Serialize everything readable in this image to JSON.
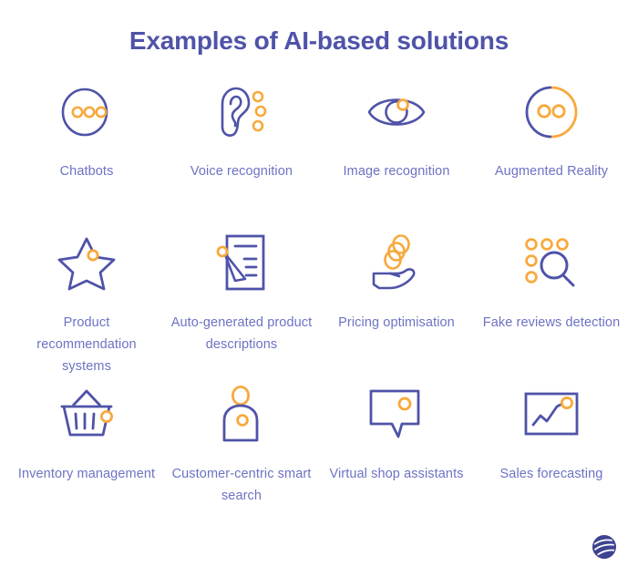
{
  "header": {
    "title": "Examples of AI-based solutions",
    "title_color": "#4f53a8"
  },
  "theme": {
    "background": "#ffffff",
    "primary": "#4f53a8",
    "accent": "#f7a93c",
    "label_color": "#6d72c3"
  },
  "items": [
    {
      "label": "Chatbots",
      "icon": "chat-circle-dots-icon"
    },
    {
      "label": "Voice recognition",
      "icon": "ear-soundwaves-icon"
    },
    {
      "label": "Image recognition",
      "icon": "eye-icon"
    },
    {
      "label": "Augmented Reality",
      "icon": "vr-goggles-icon"
    },
    {
      "label": "Product recommendation systems",
      "icon": "star-icon"
    },
    {
      "label": "Auto-generated product descriptions",
      "icon": "document-pen-icon"
    },
    {
      "label": "Pricing optimisation",
      "icon": "hand-coins-icon"
    },
    {
      "label": "Fake reviews detection",
      "icon": "magnifier-dots-icon"
    },
    {
      "label": "Inventory management",
      "icon": "shopping-basket-icon"
    },
    {
      "label": "Customer-centric smart search",
      "icon": "person-icon"
    },
    {
      "label": "Virtual shop assistants",
      "icon": "speech-bubble-icon"
    },
    {
      "label": "Sales forecasting",
      "icon": "trend-chart-icon"
    }
  ],
  "footer": {
    "logo": "brand-diamond-logo"
  }
}
